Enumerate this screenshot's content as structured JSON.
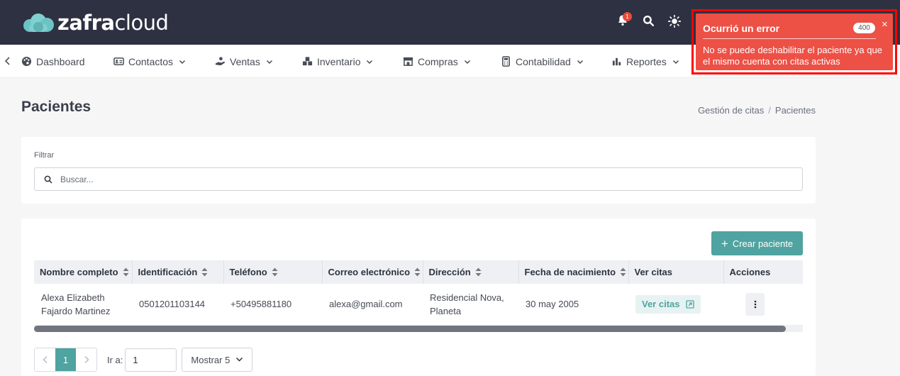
{
  "app": {
    "logo_bold": "zafra",
    "logo_light": "cloud",
    "notification_count": "1"
  },
  "icons": {
    "bell": "bell-icon",
    "search": "search-icon",
    "theme": "sun-icon",
    "back": "chevron-left-icon"
  },
  "nav": {
    "items": [
      {
        "label": "Dashboard",
        "icon": "palette-icon",
        "has_dropdown": false
      },
      {
        "label": "Contactos",
        "icon": "id-card-icon",
        "has_dropdown": true
      },
      {
        "label": "Ventas",
        "icon": "hand-coin-icon",
        "has_dropdown": true
      },
      {
        "label": "Inventario",
        "icon": "boxes-icon",
        "has_dropdown": true
      },
      {
        "label": "Compras",
        "icon": "store-icon",
        "has_dropdown": true
      },
      {
        "label": "Contabilidad",
        "icon": "calculator-icon",
        "has_dropdown": true
      },
      {
        "label": "Reportes",
        "icon": "bar-chart-icon",
        "has_dropdown": true
      }
    ]
  },
  "page": {
    "title": "Pacientes",
    "breadcrumb": [
      "Gestión de citas",
      "/",
      "Pacientes"
    ]
  },
  "filter": {
    "label": "Filtrar",
    "search_placeholder": "Buscar..."
  },
  "table": {
    "create_button": "Crear paciente",
    "columns": [
      "Nombre completo",
      "Identificación",
      "Teléfono",
      "Correo electrónico",
      "Dirección",
      "Fecha de nacimiento",
      "Ver citas",
      "Acciones"
    ],
    "rows": [
      {
        "name": "Alexa Elizabeth Fajardo Martinez",
        "identification": "0501201103144",
        "phone": "+50495881180",
        "email": "alexa@gmail.com",
        "address": "Residencial Nova, Planeta",
        "birthdate": "30 may 2005",
        "view_label": "Ver citas"
      }
    ]
  },
  "pagination": {
    "current_page": "1",
    "goto_label": "Ir a:",
    "goto_value": "1",
    "page_size_label": "Mostrar 5"
  },
  "toast": {
    "title": "Ocurrió un error",
    "code": "400",
    "close": "×",
    "message": "No se puede deshabilitar el paciente ya que el mismo cuenta con citas activas",
    "color": "#ed5045"
  },
  "colors": {
    "topbar": "#2d3142",
    "accent": "#4fa3a0",
    "logo_cloud": "#6cc3c3"
  }
}
